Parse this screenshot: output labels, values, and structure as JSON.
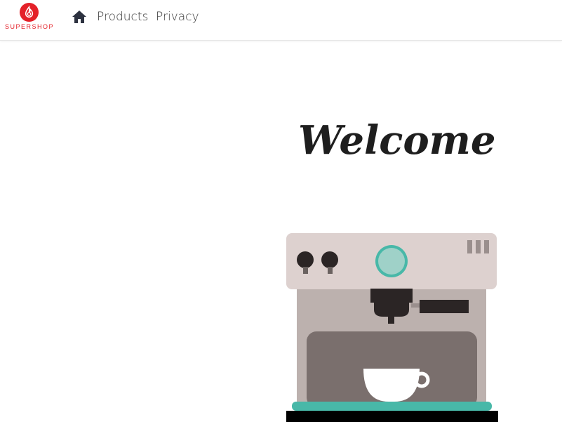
{
  "brand": {
    "name": "SUPERSHOP",
    "logo_icon": "flame-drop-icon",
    "color": "#e42129"
  },
  "nav": {
    "home_icon": "home-icon",
    "items": [
      {
        "label": "Products"
      },
      {
        "label": "Privacy"
      }
    ]
  },
  "hero": {
    "title": "Welcome",
    "illustration": "espresso-machine-illustration"
  },
  "colors": {
    "machine_top": "#ddd1cf",
    "machine_body": "#bcb1ae",
    "machine_inner": "#7a6f6d",
    "teal": "#48b8a8",
    "dark": "#2b2525"
  }
}
